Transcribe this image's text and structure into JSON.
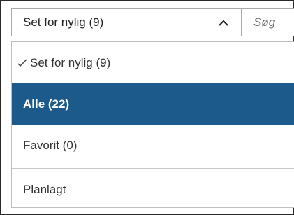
{
  "select": {
    "value": "Set for nylig (9)",
    "expanded": true
  },
  "search": {
    "placeholder": "Søg"
  },
  "options": [
    {
      "label": "Set for nylig (9)",
      "checked": true
    },
    {
      "label": "Alle (22)",
      "highlighted": true
    },
    {
      "label": "Favorit (0)"
    },
    {
      "label": "Planlagt"
    }
  ],
  "colors": {
    "highlight": "#1b5a8a",
    "highlight_text": "#ffffff"
  }
}
